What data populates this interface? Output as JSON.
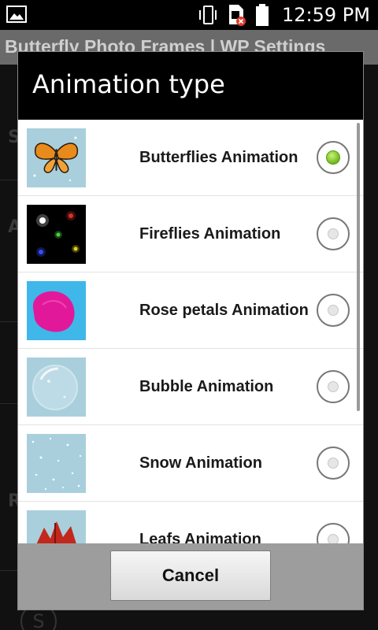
{
  "status_bar": {
    "time": "12:59 PM",
    "icons": [
      "gallery-icon",
      "vibrate-icon",
      "sim-error-icon",
      "battery-icon"
    ]
  },
  "background": {
    "title": "Butterfly Photo Frames | WP Settings",
    "section_letters": [
      "S",
      "A",
      "R"
    ]
  },
  "dialog": {
    "title": "Animation type",
    "options": [
      {
        "label": "Butterflies Animation",
        "selected": true,
        "thumb": "butterfly"
      },
      {
        "label": "Fireflies Animation",
        "selected": false,
        "thumb": "fireflies"
      },
      {
        "label": "Rose petals Animation",
        "selected": false,
        "thumb": "rose-petal"
      },
      {
        "label": "Bubble Animation",
        "selected": false,
        "thumb": "bubble"
      },
      {
        "label": "Snow Animation",
        "selected": false,
        "thumb": "snow"
      },
      {
        "label": "Leafs Animation",
        "selected": false,
        "thumb": "leaf"
      }
    ],
    "cancel_label": "Cancel"
  },
  "colors": {
    "radio_selected": "#6fb81c",
    "header_bg": "#000000",
    "footer_bg": "#9d9d9d"
  }
}
